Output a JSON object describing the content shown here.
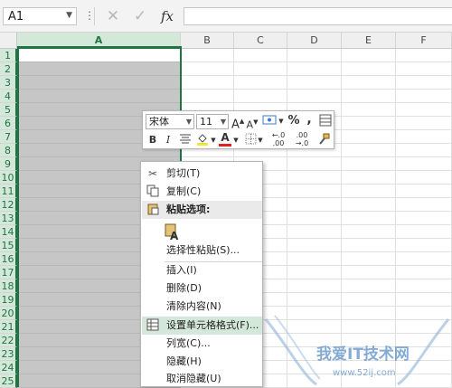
{
  "formula_bar": {
    "name_box": "A1",
    "cancel_icon": "x-icon",
    "enter_icon": "check-icon",
    "fx_label": "fx",
    "formula_value": ""
  },
  "columns": [
    "A",
    "B",
    "C",
    "D",
    "E",
    "F"
  ],
  "rows": [
    "1",
    "2",
    "3",
    "4",
    "5",
    "6",
    "7",
    "8",
    "9",
    "10",
    "11",
    "12",
    "13",
    "14",
    "15",
    "16",
    "17",
    "18",
    "19",
    "20",
    "21",
    "22",
    "23",
    "24",
    "25"
  ],
  "selected_column": "A",
  "mini_toolbar": {
    "font_name": "宋体",
    "font_size": "11",
    "grow_font": "A",
    "shrink_font": "A",
    "percent": "%",
    "comma": ",",
    "bold": "B",
    "italic": "I",
    "font_color_letter": "A",
    "increase_decimal": "←.0 .00",
    "decrease_decimal": ".00 →.0"
  },
  "context_menu": {
    "items": [
      {
        "label": "剪切(T)",
        "icon": "scissors-icon"
      },
      {
        "label": "复制(C)",
        "icon": "copy-icon"
      },
      {
        "label": "粘贴选项:",
        "icon": "paste-icon"
      },
      {
        "label": "A",
        "icon": "paste-option-icon"
      },
      {
        "label": "选择性粘贴(S)...",
        "icon": ""
      },
      {
        "label": "插入(I)",
        "icon": ""
      },
      {
        "label": "删除(D)",
        "icon": ""
      },
      {
        "label": "清除内容(N)",
        "icon": ""
      },
      {
        "label": "设置单元格格式(F)...",
        "icon": "format-cells-icon"
      },
      {
        "label": "列宽(C)...",
        "icon": ""
      },
      {
        "label": "隐藏(H)",
        "icon": ""
      },
      {
        "label": "取消隐藏(U)",
        "icon": ""
      }
    ]
  },
  "watermark": {
    "text": "我爱IT技术网",
    "url": "www.52ij.com"
  },
  "colors": {
    "accent": "#217346",
    "selection_fill": "#c6c6c6",
    "menu_highlight": "#d3e8d8"
  }
}
